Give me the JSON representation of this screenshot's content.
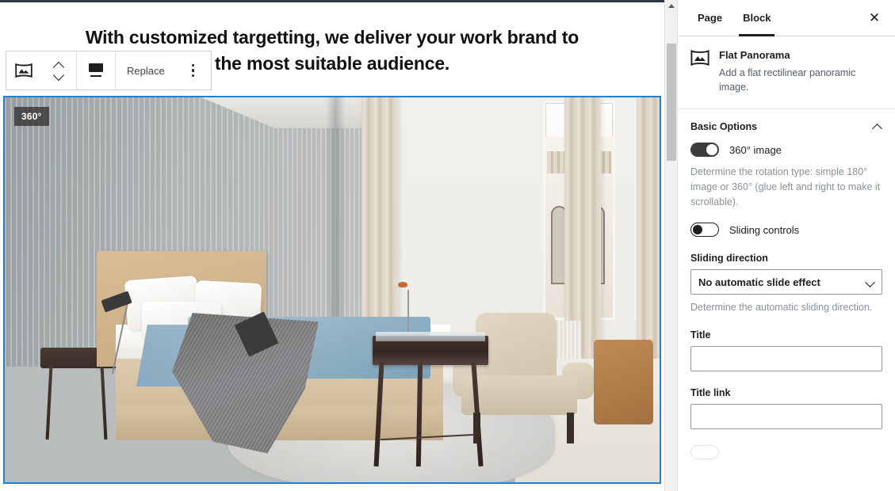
{
  "editor": {
    "post_heading": "With customized targetting, we deliver your work brand to the most suitable audience.",
    "image_badge": "360°",
    "toolbar": {
      "block_type_icon": "flat-panorama-icon",
      "move_icon": "move-up-down-icon",
      "align_icon": "align-full-width-icon",
      "replace_label": "Replace",
      "more_icon": "more-options-vertical-dots-icon"
    }
  },
  "sidebar": {
    "tabs": [
      {
        "label": "Page",
        "active": false
      },
      {
        "label": "Block",
        "active": true
      }
    ],
    "close_icon": "close-icon",
    "block_card": {
      "icon": "flat-panorama-icon",
      "title": "Flat Panorama",
      "description": "Add a flat rectilinear panoramic image."
    },
    "sections": [
      {
        "title": "Basic Options",
        "collapse_icon": "chevron-up-icon",
        "controls": {
          "toggle_360": {
            "label": "360° image",
            "state": "on"
          },
          "toggle_360_help": "Determine the rotation type: simple 180° image or 360° (glue left and right to make it scrollable).",
          "toggle_sliding_controls": {
            "label": "Sliding controls",
            "state": "off"
          },
          "sliding_direction": {
            "label": "Sliding direction",
            "value": "No automatic slide effect",
            "options": [
              "No automatic slide effect"
            ],
            "help": "Determine the automatic sliding direction."
          },
          "title_field": {
            "label": "Title",
            "value": "",
            "placeholder": ""
          },
          "title_link_field": {
            "label": "Title link",
            "value": "",
            "placeholder": ""
          }
        }
      }
    ]
  },
  "colors": {
    "selection_border": "#2a7fc4",
    "toggle_on": "#3c3c3c",
    "tab_underline": "#1e1e1e",
    "help_text": "#8a9199",
    "top_bar": "#32373c",
    "scrollbar_thumb": "#c1c1c1"
  },
  "scrollbar": {
    "name": "page-vertical-scrollbar"
  }
}
